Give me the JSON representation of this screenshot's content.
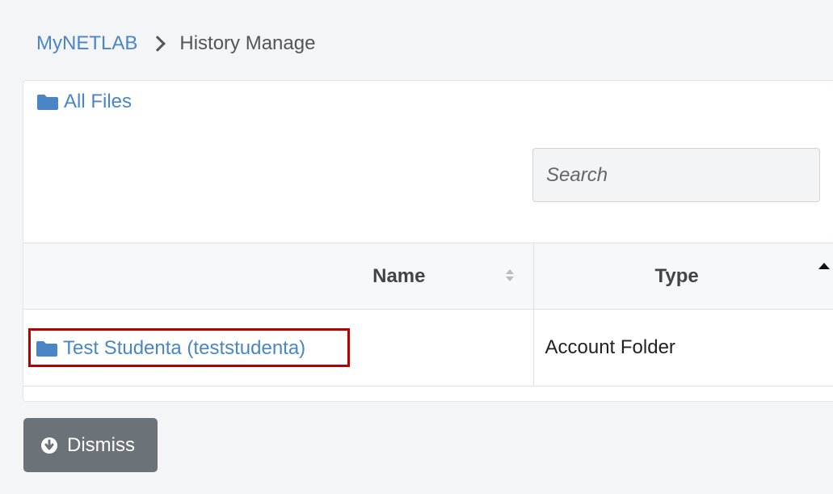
{
  "breadcrumb": {
    "root": "MyNETLAB",
    "current": "History Manage"
  },
  "panel": {
    "all_files_label": "All Files",
    "search": {
      "placeholder": "Search",
      "value": ""
    },
    "table": {
      "columns": [
        "Name",
        "Type"
      ],
      "rows": [
        {
          "name": "Test Studenta (teststudenta)",
          "type": "Account Folder"
        }
      ]
    }
  },
  "actions": {
    "dismiss_label": "Dismiss"
  },
  "icons": {
    "folder": "folder-icon",
    "dismiss": "arrow-circle-down-icon",
    "breadcrumb_separator": "chevron-right-icon",
    "sort_name": "sort-icon",
    "sort_type": "sort-ascending-icon"
  },
  "colors": {
    "link": "#4a86c5",
    "highlight_border": "#b70000",
    "dismiss_button": "#6b7278"
  }
}
